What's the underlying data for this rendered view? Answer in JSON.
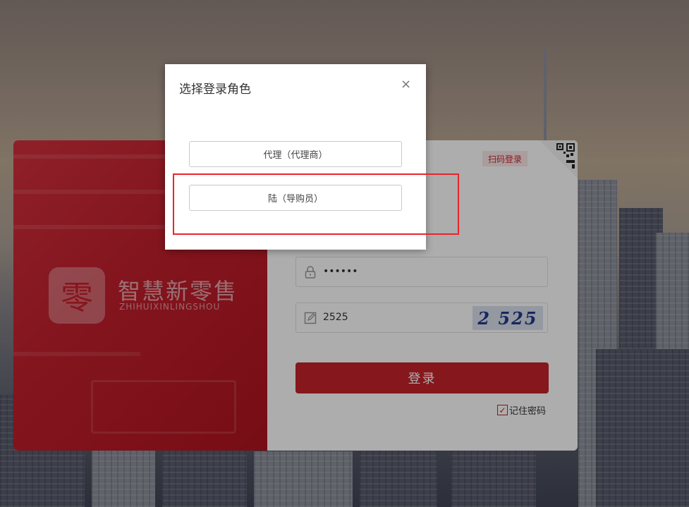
{
  "background": {
    "overlay_color": "#000000"
  },
  "logo": {
    "glyph": "零",
    "title": "智慧新零售",
    "subtitle": "ZHIHUIXINLINGSHOU"
  },
  "login": {
    "scan_badge": "扫码登录",
    "password_value": "••••••",
    "captcha_value": "2525",
    "captcha_image_text": "2 525",
    "submit_label": "登录",
    "remember_label": "记住密码",
    "remember_checked": true
  },
  "modal": {
    "title": "选择登录角色",
    "close_glyph": "×",
    "roles": [
      {
        "label": "代理（代理商）"
      },
      {
        "label": "陆（导购员）"
      }
    ]
  },
  "colors": {
    "brand_red": "#c4232b",
    "highlight_red": "#e8262a"
  },
  "icons": [
    "lock-icon",
    "edit-icon",
    "qrcode-icon",
    "close-icon",
    "check-icon"
  ]
}
